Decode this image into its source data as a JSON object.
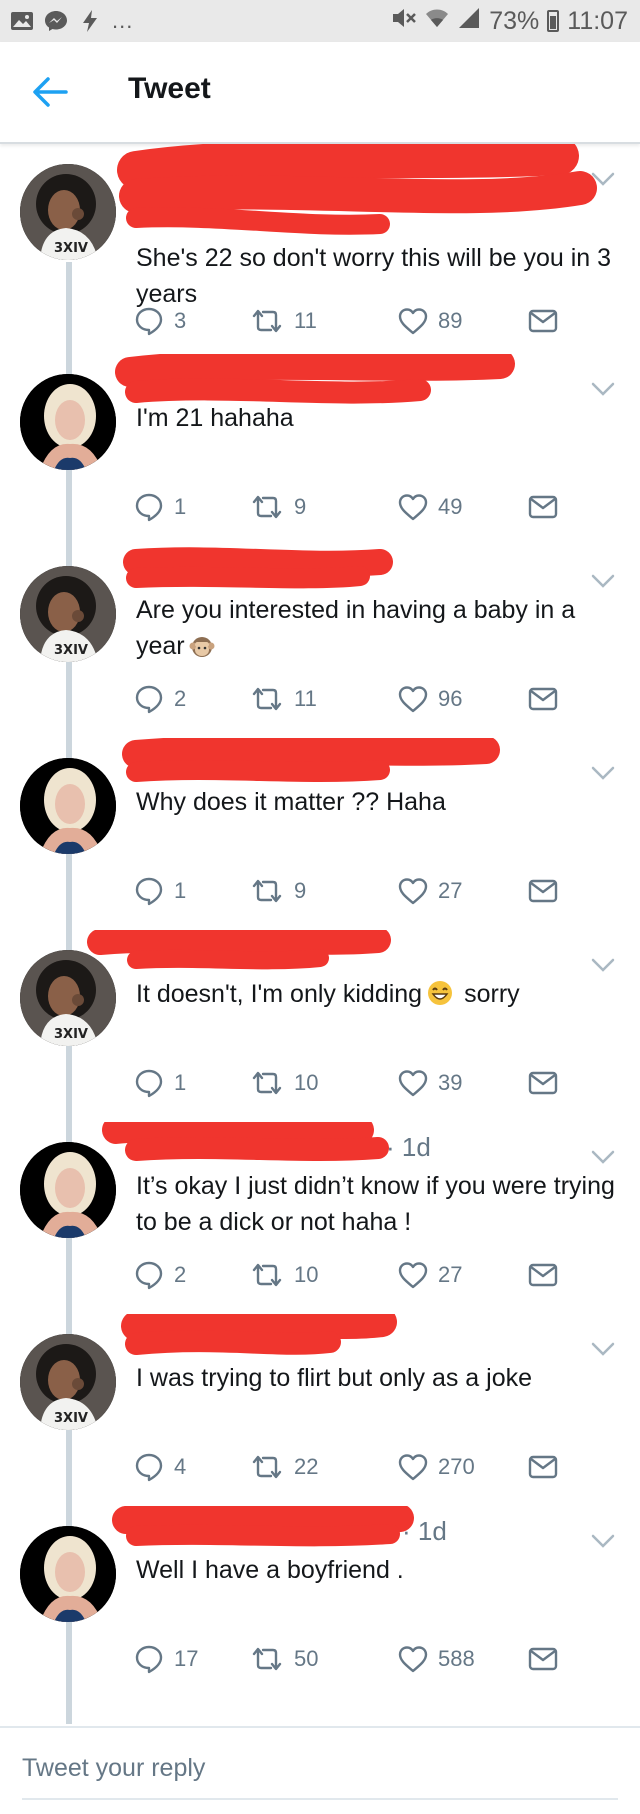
{
  "status_bar": {
    "left_icons": [
      "image-icon",
      "messenger-icon",
      "flash-icon"
    ],
    "more": "...",
    "right_icons": [
      "mute-icon",
      "wifi-icon",
      "signal-icon",
      "battery-icon"
    ],
    "battery": "73%",
    "time": "11:07"
  },
  "header": {
    "back_icon": "back-arrow-icon",
    "title": "Tweet"
  },
  "colors": {
    "twitter_blue": "#1da1f2",
    "icon_gray": "#657786",
    "thread_line": "#ccd6dd",
    "redaction": "#f0352e"
  },
  "tweets": [
    {
      "author": "user-a",
      "text": "She's 22 so don't worry this will be you in 3 years",
      "replies": "3",
      "retweets": "11",
      "likes": "89"
    },
    {
      "author": "user-b",
      "text": "I'm 21 hahaha",
      "replies": "1",
      "retweets": "9",
      "likes": "49"
    },
    {
      "author": "user-a",
      "text": "Are you interested in having a baby in a year",
      "replies": "2",
      "retweets": "11",
      "likes": "96"
    },
    {
      "author": "user-b",
      "text": "Why does it matter ?? Haha",
      "replies": "1",
      "retweets": "9",
      "likes": "27"
    },
    {
      "author": "user-a",
      "text": "It doesn't, I'm only kidding",
      "text_after_emoji": "sorry",
      "replies": "1",
      "retweets": "10",
      "likes": "39"
    },
    {
      "author": "user-b",
      "time": "· 1d",
      "text": "It’s okay I just didn’t know if you were trying to be a dick or not haha !",
      "replies": "2",
      "retweets": "10",
      "likes": "27"
    },
    {
      "author": "user-a",
      "text": "I was trying to flirt but only as a joke",
      "replies": "4",
      "retweets": "22",
      "likes": "270"
    },
    {
      "author": "user-b",
      "time": "· 1d",
      "text": "Well I have a boyfriend .",
      "replies": "17",
      "retweets": "50",
      "likes": "588"
    }
  ],
  "reply_bar": {
    "placeholder": "Tweet your reply"
  }
}
